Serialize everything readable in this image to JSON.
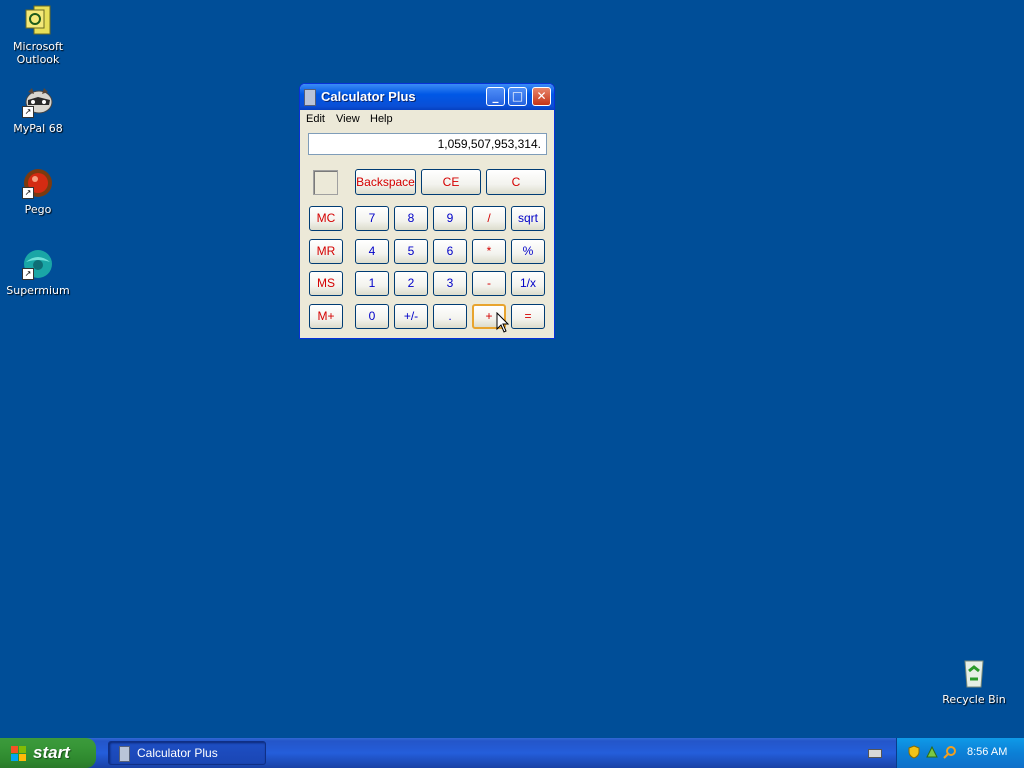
{
  "desktop": {
    "icons": [
      {
        "label_line1": "Microsoft",
        "label_line2": "Outlook"
      },
      {
        "label_line1": "MyPal 68",
        "label_line2": ""
      },
      {
        "label_line1": "Pego",
        "label_line2": ""
      },
      {
        "label_line1": "Supermium",
        "label_line2": ""
      },
      {
        "label_line1": "Recycle Bin",
        "label_line2": ""
      }
    ]
  },
  "window": {
    "title": "Calculator Plus",
    "minimize_glyph": "_",
    "maximize_glyph": "□",
    "close_glyph": "✕"
  },
  "menu": {
    "edit": "Edit",
    "view": "View",
    "help": "Help"
  },
  "display": {
    "value": "1,059,507,953,314."
  },
  "buttons": {
    "backspace": "Backspace",
    "ce": "CE",
    "c": "C",
    "mc": "MC",
    "mr": "MR",
    "ms": "MS",
    "mplus": "M+",
    "d7": "7",
    "d8": "8",
    "d9": "9",
    "d4": "4",
    "d5": "5",
    "d6": "6",
    "d1": "1",
    "d2": "2",
    "d3": "3",
    "d0": "0",
    "sign": "+/-",
    "dot": ".",
    "div": "/",
    "mul": "*",
    "sub": "-",
    "add": "+",
    "sqrt": "sqrt",
    "pct": "%",
    "recip": "1/x",
    "eq": "="
  },
  "taskbar": {
    "start_label": "start",
    "task_calc_label": "Calculator Plus",
    "clock": "8:56 AM"
  },
  "colors": {
    "desktop": "#004e98",
    "digit_text": "#0000c8",
    "operator_text": "#d40000"
  }
}
